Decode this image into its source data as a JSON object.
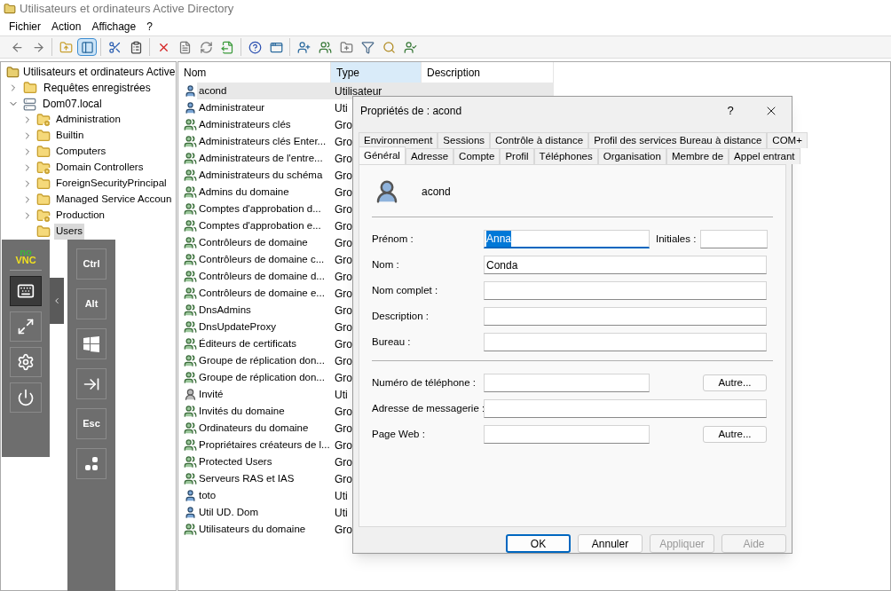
{
  "window": {
    "title": "Utilisateurs et ordinateurs Active Directory"
  },
  "menu": [
    "Fichier",
    "Action",
    "Affichage",
    "?"
  ],
  "toolbar_groups": [
    {
      "buttons": [
        {
          "kind": "back",
          "selected": false
        },
        {
          "kind": "forward",
          "selected": false
        }
      ]
    },
    {
      "buttons": [
        {
          "kind": "up",
          "selected": false
        },
        {
          "kind": "tree",
          "selected": true
        }
      ]
    },
    {
      "buttons": [
        {
          "kind": "cut",
          "selected": false
        },
        {
          "kind": "paste",
          "selected": false
        }
      ]
    },
    {
      "buttons": [
        {
          "kind": "delete",
          "selected": false
        },
        {
          "kind": "properties",
          "selected": false
        },
        {
          "kind": "refresh",
          "selected": false
        },
        {
          "kind": "export",
          "selected": false
        }
      ]
    },
    {
      "buttons": [
        {
          "kind": "help",
          "selected": false
        },
        {
          "kind": "console",
          "selected": false
        }
      ]
    },
    {
      "buttons": [
        {
          "kind": "new_user",
          "selected": false
        },
        {
          "kind": "new_group",
          "selected": false
        },
        {
          "kind": "new_ou",
          "selected": false
        },
        {
          "kind": "filter",
          "selected": false
        },
        {
          "kind": "find",
          "selected": false
        },
        {
          "kind": "add_group",
          "selected": false
        }
      ]
    }
  ],
  "tree": {
    "root": "Utilisateurs et ordinateurs Active",
    "items": [
      {
        "label": "Requêtes enregistrées",
        "kind": "folder",
        "expanded": false,
        "selected": false
      },
      {
        "label": "Dom07.local",
        "kind": "domain",
        "expanded": true,
        "selected": false,
        "children": [
          {
            "label": "Administration",
            "kind": "ou",
            "expanded": false,
            "selected": false
          },
          {
            "label": "Builtin",
            "kind": "folder",
            "expanded": false,
            "selected": false
          },
          {
            "label": "Computers",
            "kind": "folder",
            "expanded": false,
            "selected": false
          },
          {
            "label": "Domain Controllers",
            "kind": "ou",
            "expanded": false,
            "selected": false
          },
          {
            "label": "ForeignSecurityPrincipal",
            "kind": "folder",
            "expanded": false,
            "selected": false
          },
          {
            "label": "Managed Service Accoun",
            "kind": "folder",
            "expanded": false,
            "selected": false
          },
          {
            "label": "Production",
            "kind": "ou",
            "expanded": false,
            "selected": false
          },
          {
            "label": "Users",
            "kind": "folder",
            "selected": true
          }
        ]
      }
    ]
  },
  "list": {
    "columns": [
      {
        "label": "Nom",
        "highlighted": false
      },
      {
        "label": "Type",
        "highlighted": true
      },
      {
        "label": "Description",
        "highlighted": false
      }
    ],
    "rows": [
      {
        "name": "acond",
        "type": "Utilisateur",
        "kind": "user",
        "selected": true
      },
      {
        "name": "Administrateur",
        "type": "Uti",
        "kind": "user",
        "selected": false
      },
      {
        "name": "Administrateurs clés",
        "type": "Gro",
        "kind": "group",
        "selected": false
      },
      {
        "name": "Administrateurs clés Enter...",
        "type": "Gro",
        "kind": "group",
        "selected": false
      },
      {
        "name": "Administrateurs de l'entre...",
        "type": "Gro",
        "kind": "group",
        "selected": false
      },
      {
        "name": "Administrateurs du schéma",
        "type": "Gro",
        "kind": "group",
        "selected": false
      },
      {
        "name": "Admins du domaine",
        "type": "Gro",
        "kind": "group",
        "selected": false
      },
      {
        "name": "Comptes d'approbation d...",
        "type": "Gro",
        "kind": "group",
        "selected": false
      },
      {
        "name": "Comptes d'approbation e...",
        "type": "Gro",
        "kind": "group",
        "selected": false
      },
      {
        "name": "Contrôleurs de domaine",
        "type": "Gro",
        "kind": "group",
        "selected": false
      },
      {
        "name": "Contrôleurs de domaine c...",
        "type": "Gro",
        "kind": "group",
        "selected": false
      },
      {
        "name": "Contrôleurs de domaine d...",
        "type": "Gro",
        "kind": "group",
        "selected": false
      },
      {
        "name": "Contrôleurs de domaine e...",
        "type": "Gro",
        "kind": "group",
        "selected": false
      },
      {
        "name": "DnsAdmins",
        "type": "Gro",
        "kind": "group",
        "selected": false
      },
      {
        "name": "DnsUpdateProxy",
        "type": "Gro",
        "kind": "group",
        "selected": false
      },
      {
        "name": "Éditeurs de certificats",
        "type": "Gro",
        "kind": "group",
        "selected": false
      },
      {
        "name": "Groupe de réplication don...",
        "type": "Gro",
        "kind": "group",
        "selected": false
      },
      {
        "name": "Groupe de réplication don...",
        "type": "Gro",
        "kind": "group",
        "selected": false
      },
      {
        "name": "Invité",
        "type": "Uti",
        "kind": "guest",
        "selected": false
      },
      {
        "name": "Invités du domaine",
        "type": "Gro",
        "kind": "group",
        "selected": false
      },
      {
        "name": "Ordinateurs du domaine",
        "type": "Gro",
        "kind": "group",
        "selected": false
      },
      {
        "name": "Propriétaires créateurs de l...",
        "type": "Gro",
        "kind": "group",
        "selected": false
      },
      {
        "name": "Protected Users",
        "type": "Gro",
        "kind": "group",
        "selected": false
      },
      {
        "name": "Serveurs RAS et IAS",
        "type": "Gro",
        "kind": "group",
        "selected": false
      },
      {
        "name": "toto",
        "type": "Uti",
        "kind": "user",
        "selected": false
      },
      {
        "name": "Util UD. Dom",
        "type": "Uti",
        "kind": "user",
        "selected": false
      },
      {
        "name": "Utilisateurs du domaine",
        "type": "Gro",
        "kind": "group",
        "selected": false
      }
    ]
  },
  "dialog": {
    "title": "Propriétés de : acond",
    "help": "?",
    "tab_rows": [
      [
        {
          "label": "Environnement",
          "selected": false
        },
        {
          "label": "Sessions",
          "selected": false
        },
        {
          "label": "Contrôle à distance",
          "selected": false
        },
        {
          "label": "Profil des services Bureau à distance",
          "selected": false
        },
        {
          "label": "COM+",
          "selected": false
        }
      ],
      [
        {
          "label": "Général",
          "selected": true
        },
        {
          "label": "Adresse",
          "selected": false
        },
        {
          "label": "Compte",
          "selected": false
        },
        {
          "label": "Profil",
          "selected": false
        },
        {
          "label": "Téléphones",
          "selected": false
        },
        {
          "label": "Organisation",
          "selected": false
        },
        {
          "label": "Membre de",
          "selected": false
        },
        {
          "label": "Appel entrant",
          "selected": false
        }
      ]
    ],
    "user_name": "acond",
    "sections": [
      [
        {
          "kind": "with_initials",
          "label": "Prénom :",
          "value": "Anna",
          "text_selected": true,
          "focused": true,
          "extra_label": "Initiales :"
        },
        {
          "kind": "full",
          "label": "Nom :",
          "value": "Conda"
        },
        {
          "kind": "full",
          "label": "Nom complet :"
        },
        {
          "kind": "full",
          "label": "Description :"
        },
        {
          "kind": "full",
          "label": "Bureau :"
        }
      ],
      [
        {
          "kind": "with_button",
          "label": "Numéro de téléphone :",
          "button": "Autre..."
        },
        {
          "kind": "full",
          "label": "Adresse de messagerie :"
        },
        {
          "kind": "with_button",
          "label": "Page Web :",
          "button": "Autre..."
        }
      ]
    ],
    "buttons": [
      {
        "label": "OK",
        "default": true,
        "disabled": false
      },
      {
        "label": "Annuler",
        "default": false,
        "disabled": false
      },
      {
        "label": "Appliquer",
        "default": false,
        "disabled": true
      },
      {
        "label": "Aide",
        "default": false,
        "disabled": true
      }
    ]
  },
  "vnc": {
    "logo_top": "no",
    "logo_bottom": "VNC",
    "controls": [
      {
        "kind": "keyboard",
        "selected": true
      },
      {
        "kind": "fullscreen",
        "selected": false
      },
      {
        "kind": "settings",
        "selected": false
      },
      {
        "kind": "power",
        "selected": false
      }
    ],
    "keys": [
      {
        "kind": "text",
        "label": "Ctrl"
      },
      {
        "kind": "text",
        "label": "Alt"
      },
      {
        "kind": "windows"
      },
      {
        "kind": "tab"
      },
      {
        "kind": "text",
        "label": "Esc"
      },
      {
        "kind": "extra"
      }
    ]
  }
}
